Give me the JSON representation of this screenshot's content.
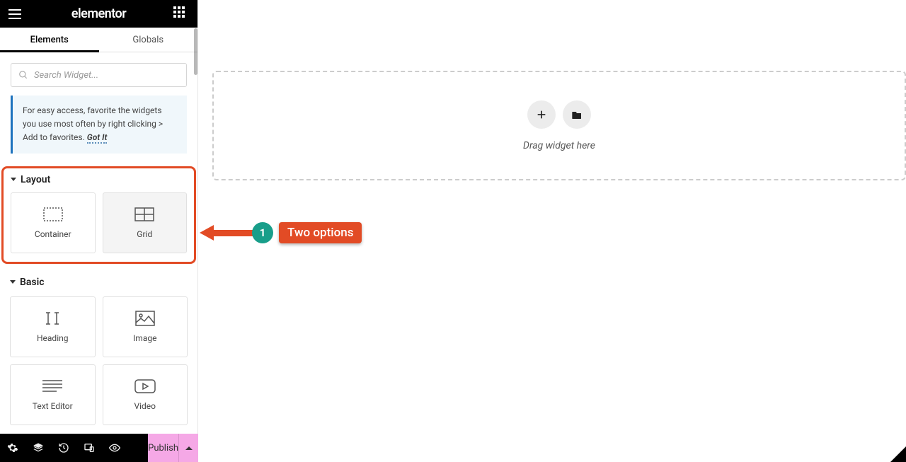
{
  "header": {
    "app_name": "elementor"
  },
  "tabs": {
    "elements": "Elements",
    "globals": "Globals"
  },
  "search": {
    "placeholder": "Search Widget..."
  },
  "tip": {
    "text": "For easy access, favorite the widgets you use most often by right clicking > Add to favorites.",
    "link": "Got It"
  },
  "sections": {
    "layout": {
      "title": "Layout",
      "widgets": [
        {
          "label": "Container"
        },
        {
          "label": "Grid"
        }
      ]
    },
    "basic": {
      "title": "Basic",
      "widgets": [
        {
          "label": "Heading"
        },
        {
          "label": "Image"
        },
        {
          "label": "Text Editor"
        },
        {
          "label": "Video"
        }
      ]
    }
  },
  "canvas": {
    "drop_label": "Drag widget here"
  },
  "bottom": {
    "publish": "Publish"
  },
  "annotation": {
    "number": "1",
    "label": "Two options"
  }
}
